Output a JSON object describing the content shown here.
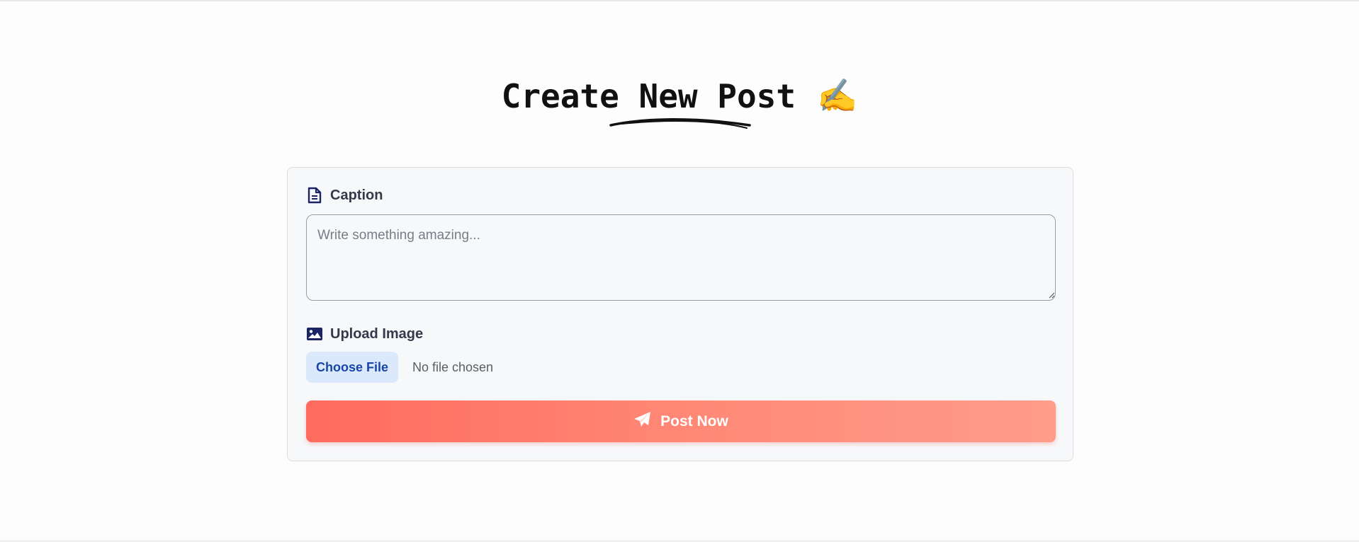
{
  "header": {
    "title": "Create New Post",
    "title_emoji": "✍️"
  },
  "form": {
    "caption": {
      "label": "Caption",
      "icon": "document-icon",
      "placeholder": "Write something amazing...",
      "value": ""
    },
    "upload": {
      "label": "Upload Image",
      "icon": "image-icon",
      "choose_button_label": "Choose File",
      "file_status": "No file chosen"
    },
    "submit": {
      "label": "Post Now",
      "icon": "paper-plane-icon"
    }
  },
  "colors": {
    "accent_label": "#343a4a",
    "icon_navy": "#1a2366",
    "button_gradient_start": "#ff6b5e",
    "button_gradient_end": "#ff9c8a",
    "file_button_bg": "#dce9fc",
    "file_button_text": "#1746a8"
  }
}
